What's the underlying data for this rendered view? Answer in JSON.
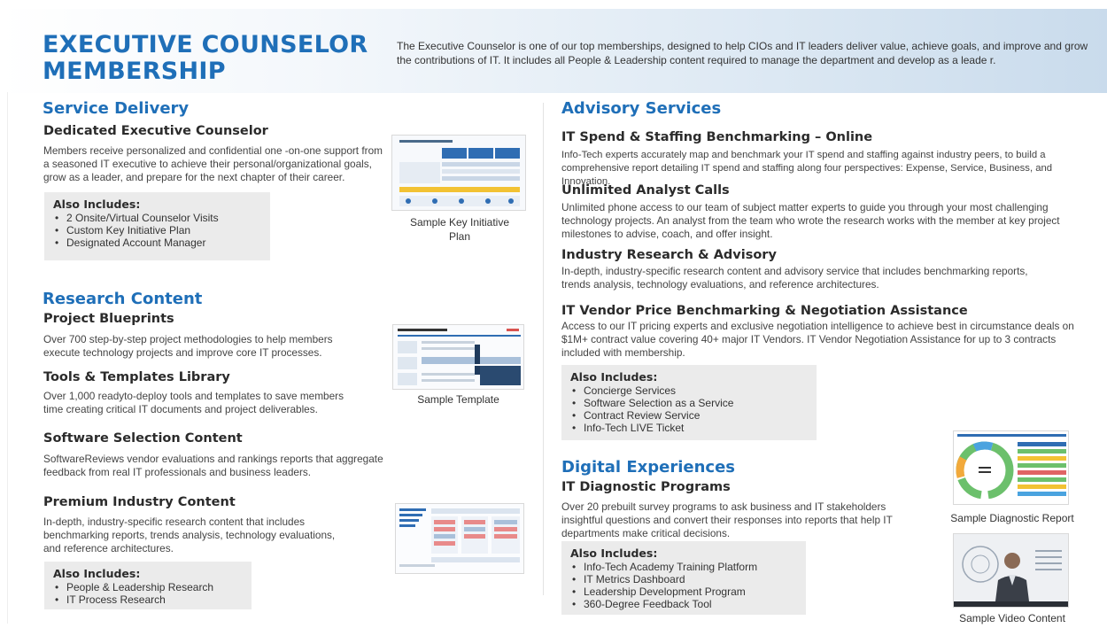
{
  "header": {
    "title": "EXECUTIVE COUNSELOR MEMBERSHIP",
    "intro": "The Executive Counselor is one of our top memberships, designed to help CIOs and IT leaders deliver value, achieve goals, and improve and grow the contributions of IT. It includes all People & Leadership content required to manage the department and develop as a leade r."
  },
  "service_delivery": {
    "heading": "Service Delivery",
    "item_title": "Dedicated Executive Counselor",
    "item_text": "Members receive personalized and confidential one -on-one support from a seasoned IT executive to achieve their personal/organizational goals, grow as a leader, and prepare for the next chapter of their career.",
    "also_title": "Also Includes:",
    "also_items": [
      "2 Onsite/Virtual Counselor Visits",
      "Custom Key Initiative Plan",
      "Designated Account Manager"
    ],
    "caption": "Sample Key Initiative Plan"
  },
  "research_content": {
    "heading": "Research Content",
    "items": [
      {
        "title": "Project Blueprints",
        "text": "Over 700 step-by-step project methodologies to help members execute technology projects and improve core IT processes."
      },
      {
        "title": "Tools & Templates Library",
        "text": "Over 1,000 readyto-deploy tools and templates to save members time creating critical IT documents and project deliverables."
      },
      {
        "title": "Software Selection Content",
        "text": "SoftwareReviews vendor evaluations and rankings reports that aggregate feedback from real IT professionals and business leaders."
      },
      {
        "title": "Premium Industry Content",
        "text": "In-depth, industry-specific research content that includes benchmarking reports, trends analysis, technology evaluations, and reference architectures."
      }
    ],
    "also_title": "Also Includes:",
    "also_items": [
      "People & Leadership Research",
      "IT Process Research"
    ],
    "caption_template": "Sample Template"
  },
  "advisory_services": {
    "heading": "Advisory Services",
    "items": [
      {
        "title": "IT Spend & Staffing Benchmarking – Online",
        "text": "Info-Tech experts accurately map and benchmark your IT spend and staffing against industry peers, to build a comprehensive report detailing IT spend and staffing along four perspectives: Expense, Service, Business, and Innovation."
      },
      {
        "title": "Unlimited Analyst Calls",
        "text": "Unlimited phone access to our team of subject matter experts to guide you through your most challenging technology projects. An analyst from the team who wrote the research works with the member at key project milestones to advise, coach, and offer insight."
      },
      {
        "title": "Industry Research & Advisory",
        "text": "In-depth, industry-specific research content and advisory service that includes benchmarking reports, trends analysis, technology evaluations, and reference architectures."
      },
      {
        "title": "IT Vendor Price Benchmarking & Negotiation Assistance",
        "text": "Access to our IT pricing experts and exclusive negotiation intelligence to achieve best in circumstance deals on $1M+ contract value covering 40+ major IT Vendors. IT Vendor Negotiation Assistance for up to 3 contracts included with membership."
      }
    ],
    "also_title": "Also Includes:",
    "also_items": [
      "Concierge Services",
      "Software Selection as a Service",
      "Contract Review Service",
      "Info-Tech LIVE Ticket"
    ]
  },
  "digital_experiences": {
    "heading": "Digital Experiences",
    "item_title": "IT Diagnostic Programs",
    "item_text": "Over 20 prebuilt survey programs to ask business and IT stakeholders insightful questions and convert their responses into reports that help IT departments make critical decisions.",
    "also_title": "Also Includes:",
    "also_items": [
      "Info-Tech Academy Training Platform",
      "IT Metrics Dashboard",
      "Leadership Development Program",
      "360-Degree Feedback Tool"
    ],
    "caption_diagnostic": "Sample Diagnostic Report",
    "caption_video": "Sample Video Content"
  },
  "colors": {
    "accent": "#1f6fb8",
    "box_bg": "#ebebeb"
  }
}
